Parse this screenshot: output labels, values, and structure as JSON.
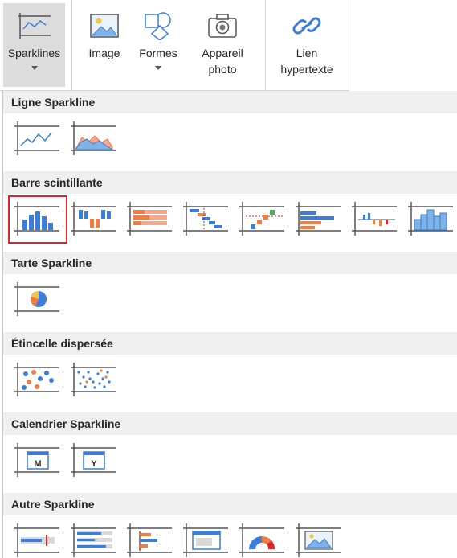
{
  "ribbon": {
    "sparklines_label": "Sparklines",
    "image_label": "Image",
    "formes_label": "Formes",
    "appareil_label_1": "Appareil",
    "appareil_label_2": "photo",
    "lien_label_1": "Lien",
    "lien_label_2": "hypertexte"
  },
  "sections": {
    "ligne": {
      "title": "Ligne Sparkline"
    },
    "barre": {
      "title": "Barre scintillante"
    },
    "tarte": {
      "title": "Tarte Sparkline"
    },
    "etincelle": {
      "title": "Étincelle dispersée"
    },
    "calendrier": {
      "title": "Calendrier Sparkline",
      "month_letter": "M",
      "year_letter": "Y"
    },
    "autre": {
      "title": "Autre Sparkline"
    }
  },
  "colors": {
    "accent_blue": "#3b7dd8",
    "accent_orange": "#f07d43",
    "accent_green": "#4caf50",
    "accent_yellow": "#f2c744",
    "frame_gray": "#555555",
    "selection_red": "#d9262b"
  }
}
